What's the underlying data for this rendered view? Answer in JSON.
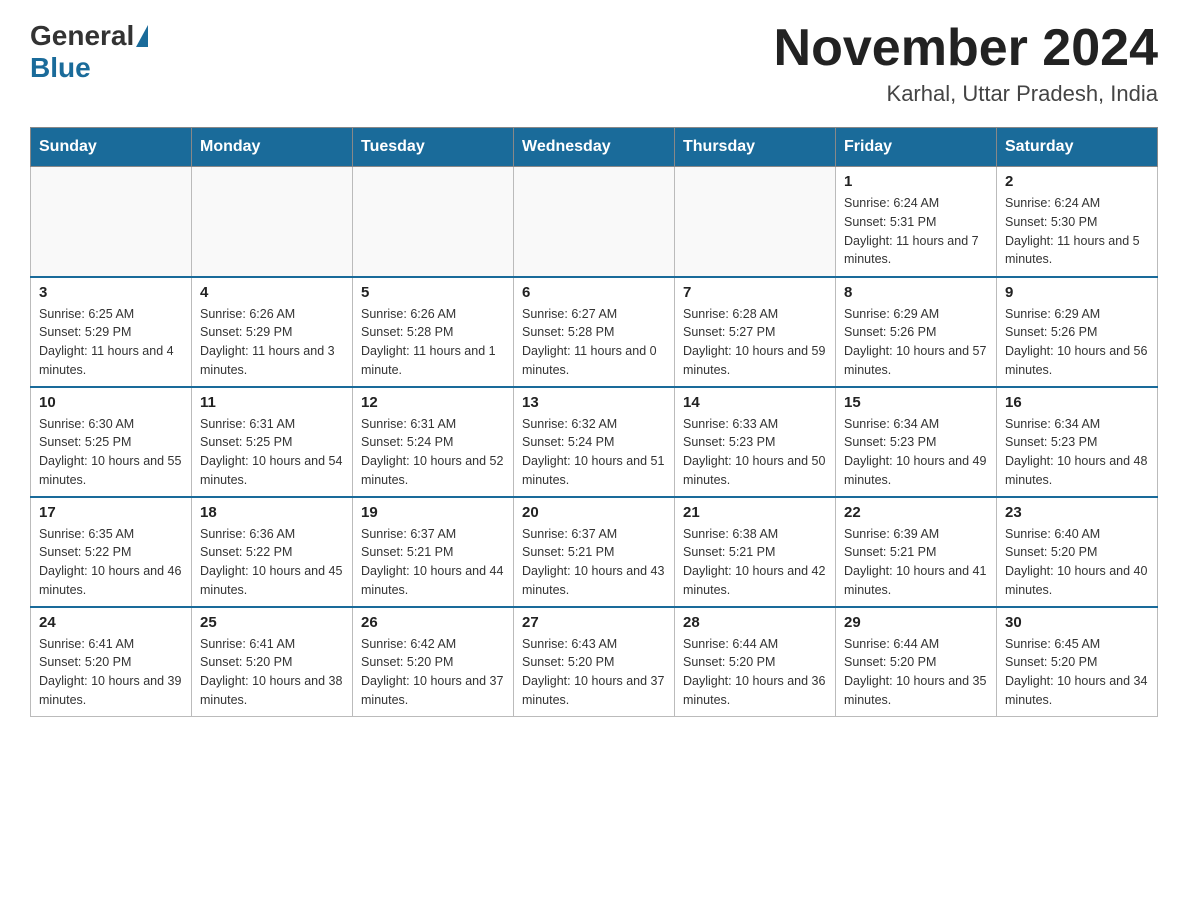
{
  "header": {
    "logo": {
      "general": "General",
      "blue": "Blue"
    },
    "title": "November 2024",
    "location": "Karhal, Uttar Pradesh, India"
  },
  "weekdays": [
    "Sunday",
    "Monday",
    "Tuesday",
    "Wednesday",
    "Thursday",
    "Friday",
    "Saturday"
  ],
  "weeks": [
    [
      {
        "day": "",
        "info": ""
      },
      {
        "day": "",
        "info": ""
      },
      {
        "day": "",
        "info": ""
      },
      {
        "day": "",
        "info": ""
      },
      {
        "day": "",
        "info": ""
      },
      {
        "day": "1",
        "info": "Sunrise: 6:24 AM\nSunset: 5:31 PM\nDaylight: 11 hours and 7 minutes."
      },
      {
        "day": "2",
        "info": "Sunrise: 6:24 AM\nSunset: 5:30 PM\nDaylight: 11 hours and 5 minutes."
      }
    ],
    [
      {
        "day": "3",
        "info": "Sunrise: 6:25 AM\nSunset: 5:29 PM\nDaylight: 11 hours and 4 minutes."
      },
      {
        "day": "4",
        "info": "Sunrise: 6:26 AM\nSunset: 5:29 PM\nDaylight: 11 hours and 3 minutes."
      },
      {
        "day": "5",
        "info": "Sunrise: 6:26 AM\nSunset: 5:28 PM\nDaylight: 11 hours and 1 minute."
      },
      {
        "day": "6",
        "info": "Sunrise: 6:27 AM\nSunset: 5:28 PM\nDaylight: 11 hours and 0 minutes."
      },
      {
        "day": "7",
        "info": "Sunrise: 6:28 AM\nSunset: 5:27 PM\nDaylight: 10 hours and 59 minutes."
      },
      {
        "day": "8",
        "info": "Sunrise: 6:29 AM\nSunset: 5:26 PM\nDaylight: 10 hours and 57 minutes."
      },
      {
        "day": "9",
        "info": "Sunrise: 6:29 AM\nSunset: 5:26 PM\nDaylight: 10 hours and 56 minutes."
      }
    ],
    [
      {
        "day": "10",
        "info": "Sunrise: 6:30 AM\nSunset: 5:25 PM\nDaylight: 10 hours and 55 minutes."
      },
      {
        "day": "11",
        "info": "Sunrise: 6:31 AM\nSunset: 5:25 PM\nDaylight: 10 hours and 54 minutes."
      },
      {
        "day": "12",
        "info": "Sunrise: 6:31 AM\nSunset: 5:24 PM\nDaylight: 10 hours and 52 minutes."
      },
      {
        "day": "13",
        "info": "Sunrise: 6:32 AM\nSunset: 5:24 PM\nDaylight: 10 hours and 51 minutes."
      },
      {
        "day": "14",
        "info": "Sunrise: 6:33 AM\nSunset: 5:23 PM\nDaylight: 10 hours and 50 minutes."
      },
      {
        "day": "15",
        "info": "Sunrise: 6:34 AM\nSunset: 5:23 PM\nDaylight: 10 hours and 49 minutes."
      },
      {
        "day": "16",
        "info": "Sunrise: 6:34 AM\nSunset: 5:23 PM\nDaylight: 10 hours and 48 minutes."
      }
    ],
    [
      {
        "day": "17",
        "info": "Sunrise: 6:35 AM\nSunset: 5:22 PM\nDaylight: 10 hours and 46 minutes."
      },
      {
        "day": "18",
        "info": "Sunrise: 6:36 AM\nSunset: 5:22 PM\nDaylight: 10 hours and 45 minutes."
      },
      {
        "day": "19",
        "info": "Sunrise: 6:37 AM\nSunset: 5:21 PM\nDaylight: 10 hours and 44 minutes."
      },
      {
        "day": "20",
        "info": "Sunrise: 6:37 AM\nSunset: 5:21 PM\nDaylight: 10 hours and 43 minutes."
      },
      {
        "day": "21",
        "info": "Sunrise: 6:38 AM\nSunset: 5:21 PM\nDaylight: 10 hours and 42 minutes."
      },
      {
        "day": "22",
        "info": "Sunrise: 6:39 AM\nSunset: 5:21 PM\nDaylight: 10 hours and 41 minutes."
      },
      {
        "day": "23",
        "info": "Sunrise: 6:40 AM\nSunset: 5:20 PM\nDaylight: 10 hours and 40 minutes."
      }
    ],
    [
      {
        "day": "24",
        "info": "Sunrise: 6:41 AM\nSunset: 5:20 PM\nDaylight: 10 hours and 39 minutes."
      },
      {
        "day": "25",
        "info": "Sunrise: 6:41 AM\nSunset: 5:20 PM\nDaylight: 10 hours and 38 minutes."
      },
      {
        "day": "26",
        "info": "Sunrise: 6:42 AM\nSunset: 5:20 PM\nDaylight: 10 hours and 37 minutes."
      },
      {
        "day": "27",
        "info": "Sunrise: 6:43 AM\nSunset: 5:20 PM\nDaylight: 10 hours and 37 minutes."
      },
      {
        "day": "28",
        "info": "Sunrise: 6:44 AM\nSunset: 5:20 PM\nDaylight: 10 hours and 36 minutes."
      },
      {
        "day": "29",
        "info": "Sunrise: 6:44 AM\nSunset: 5:20 PM\nDaylight: 10 hours and 35 minutes."
      },
      {
        "day": "30",
        "info": "Sunrise: 6:45 AM\nSunset: 5:20 PM\nDaylight: 10 hours and 34 minutes."
      }
    ]
  ]
}
